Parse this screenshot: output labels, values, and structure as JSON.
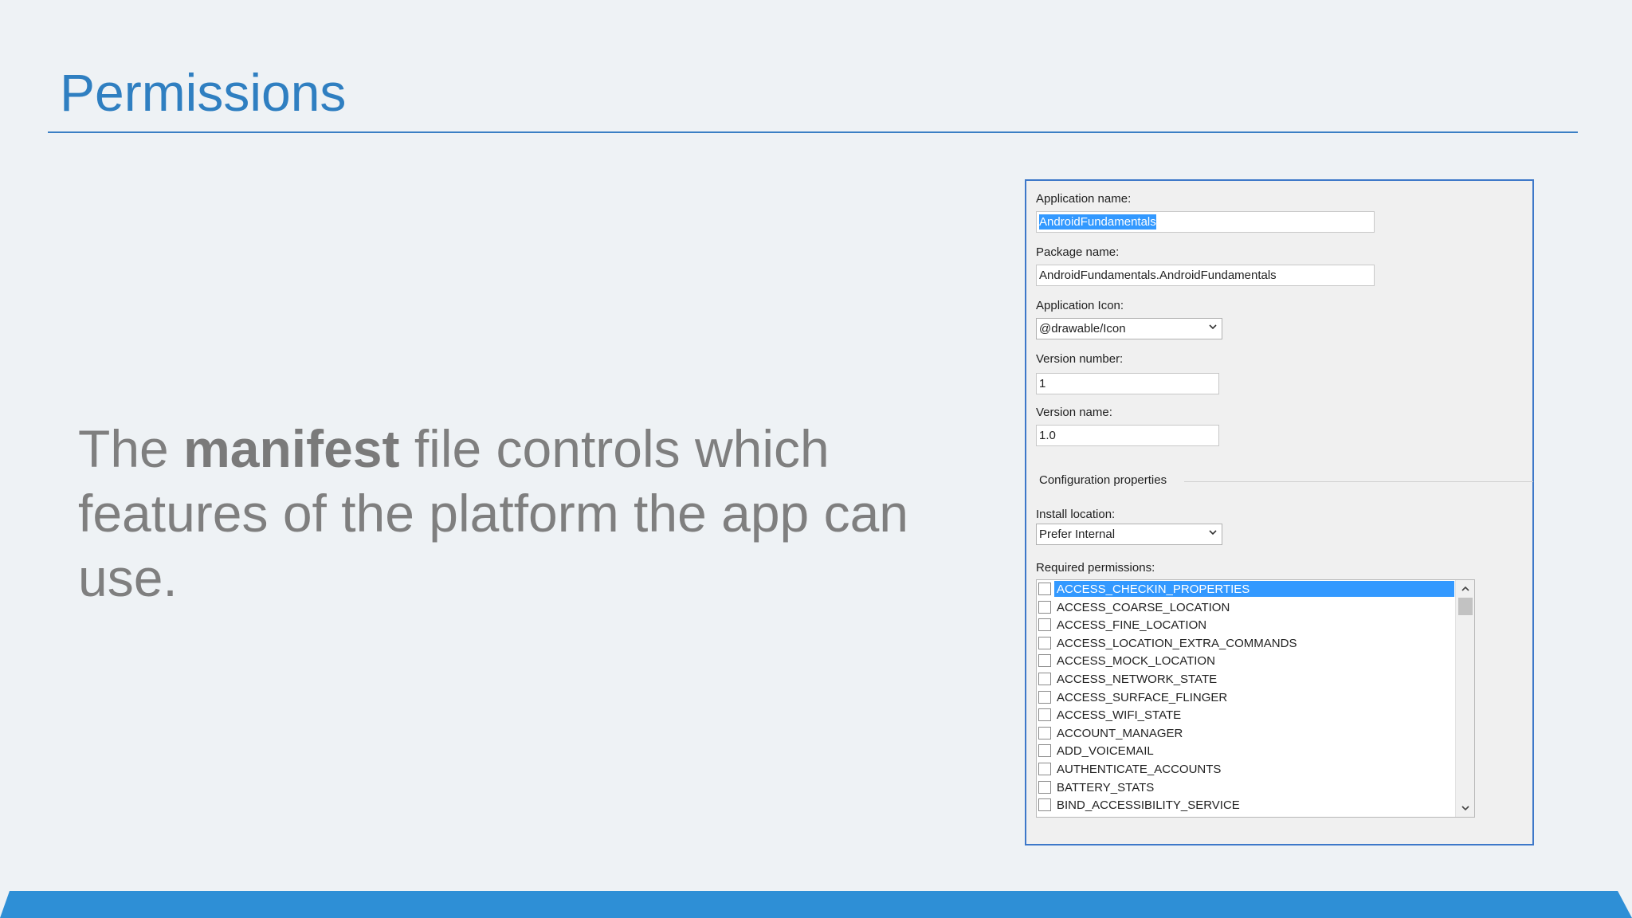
{
  "slide": {
    "title": "Permissions",
    "body_before": "The ",
    "body_bold": "manifest",
    "body_after": " file controls which features of the platform the app can use."
  },
  "form": {
    "app_name_label": "Application name:",
    "app_name_value": "AndroidFundamentals",
    "package_name_label": "Package name:",
    "package_name_value": "AndroidFundamentals.AndroidFundamentals",
    "app_icon_label": "Application Icon:",
    "app_icon_value": "@drawable/Icon",
    "version_number_label": "Version number:",
    "version_number_value": "1",
    "version_name_label": "Version name:",
    "version_name_value": "1.0",
    "config_group_label": "Configuration properties",
    "install_location_label": "Install location:",
    "install_location_value": "Prefer Internal",
    "required_permissions_label": "Required permissions:",
    "permissions": [
      {
        "name": "ACCESS_CHECKIN_PROPERTIES",
        "checked": false,
        "selected": true
      },
      {
        "name": "ACCESS_COARSE_LOCATION",
        "checked": false,
        "selected": false
      },
      {
        "name": "ACCESS_FINE_LOCATION",
        "checked": false,
        "selected": false
      },
      {
        "name": "ACCESS_LOCATION_EXTRA_COMMANDS",
        "checked": false,
        "selected": false
      },
      {
        "name": "ACCESS_MOCK_LOCATION",
        "checked": false,
        "selected": false
      },
      {
        "name": "ACCESS_NETWORK_STATE",
        "checked": false,
        "selected": false
      },
      {
        "name": "ACCESS_SURFACE_FLINGER",
        "checked": false,
        "selected": false
      },
      {
        "name": "ACCESS_WIFI_STATE",
        "checked": false,
        "selected": false
      },
      {
        "name": "ACCOUNT_MANAGER",
        "checked": false,
        "selected": false
      },
      {
        "name": "ADD_VOICEMAIL",
        "checked": false,
        "selected": false
      },
      {
        "name": "AUTHENTICATE_ACCOUNTS",
        "checked": false,
        "selected": false
      },
      {
        "name": "BATTERY_STATS",
        "checked": false,
        "selected": false
      },
      {
        "name": "BIND_ACCESSIBILITY_SERVICE",
        "checked": false,
        "selected": false
      }
    ]
  },
  "colors": {
    "title": "#2f7fc1",
    "accent_bar": "#2e8fd6",
    "selection": "#3399ff",
    "body_text": "#7f7f7f"
  },
  "icons": {
    "dropdown": "chevron-down-icon",
    "scroll_up": "chevron-up-icon",
    "scroll_down": "chevron-down-icon"
  }
}
